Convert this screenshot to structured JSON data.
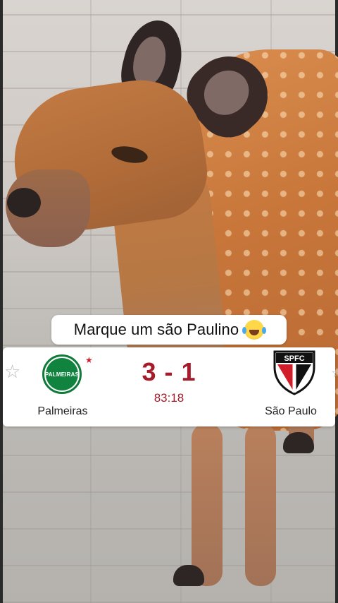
{
  "caption": {
    "text": "Marque um são Paulino",
    "emoji": "laughing-with-tears"
  },
  "match": {
    "home_team": "Palmeiras",
    "away_team": "São Paulo",
    "home_crest_text": "PALMEIRAS",
    "away_crest_text": "SPFC",
    "score": "3 - 1",
    "time": "83:18"
  },
  "colors": {
    "score": "#a51b2a",
    "palmeiras_green": "#10843f",
    "spfc_red": "#d01f2a"
  }
}
